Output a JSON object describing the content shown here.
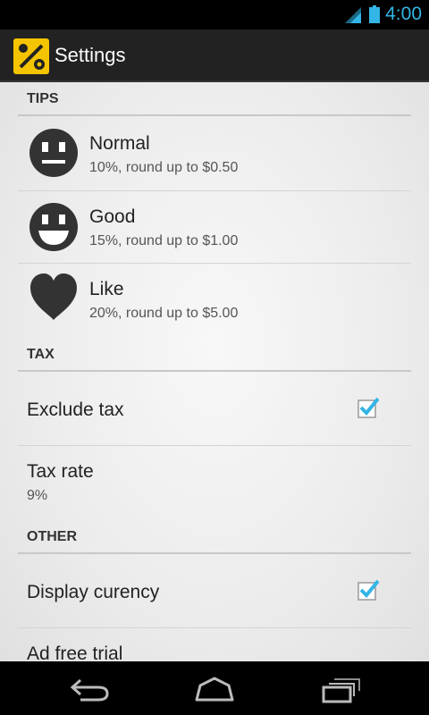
{
  "status_bar": {
    "time": "4:00",
    "icons": [
      "signal-icon",
      "battery-icon"
    ]
  },
  "action_bar": {
    "title": "Settings",
    "app_icon": "percent-coin-icon"
  },
  "sections": {
    "tips": {
      "header": "TIPS",
      "items": [
        {
          "title": "Normal",
          "summary": "10%, round up to $0.50",
          "icon": "neutral-face-icon"
        },
        {
          "title": "Good",
          "summary": "15%, round up to $1.00",
          "icon": "smiling-face-icon"
        },
        {
          "title": "Like",
          "summary": "20%, round up to $5.00",
          "icon": "heart-icon"
        }
      ]
    },
    "tax": {
      "header": "TAX",
      "exclude_tax": {
        "title": "Exclude tax",
        "checked": true
      },
      "tax_rate": {
        "title": "Tax rate",
        "summary": "9%"
      }
    },
    "other": {
      "header": "OTHER",
      "display_currency": {
        "title": "Display curency",
        "checked": true
      },
      "ad_free": {
        "title": "Ad free trial"
      }
    }
  },
  "nav_bar": {
    "icons": [
      "back-icon",
      "home-icon",
      "recent-apps-icon"
    ]
  },
  "colors": {
    "accent": "#33b5e5",
    "app_icon_yellow": "#f5c400",
    "icon_dark": "#333333"
  }
}
